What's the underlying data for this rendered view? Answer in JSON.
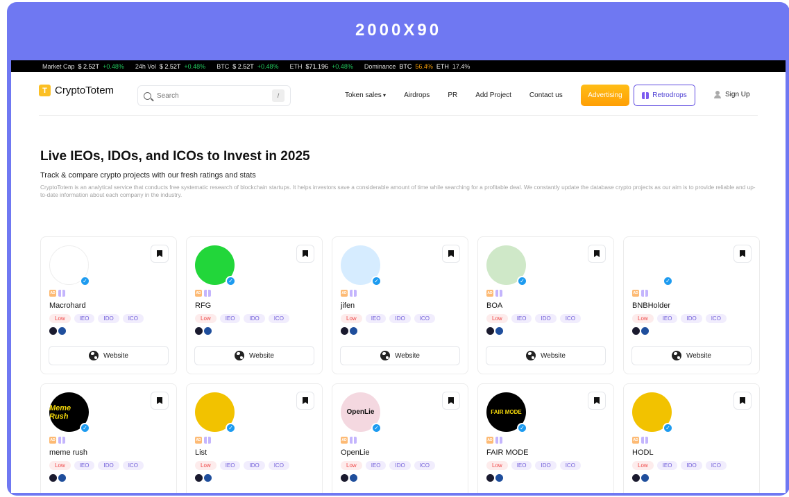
{
  "banner": {
    "text": "2000X90"
  },
  "ticker": {
    "market_cap_label": "Market Cap",
    "market_cap_value": "$ 2.52T",
    "market_cap_change": "+0.48%",
    "vol_label": "24h Vol",
    "vol_value": "$ 2.52T",
    "vol_change": "+0.48%",
    "btc_label": "BTC",
    "btc_value": "$ 2.52T",
    "btc_change": "+0.48%",
    "eth_label": "ETH",
    "eth_value": "$71.196",
    "eth_change": "+0.48%",
    "dominance_label": "Dominance",
    "dom_btc_label": "BTC",
    "dom_btc_value": "56.4%",
    "dom_eth_label": "ETH",
    "dom_eth_value": "17.4%"
  },
  "header": {
    "logo_text": "CryptoTotem",
    "search_placeholder": "Search",
    "search_shortcut": "/",
    "menu": [
      "Token sales",
      "Airdrops",
      "PR",
      "Add Project",
      "Contact us"
    ],
    "advertising_label": "Advertising",
    "retrodrops_label": "Retrodrops",
    "signup_label": "Sign Up"
  },
  "hero": {
    "title": "Live IEOs, IDOs, and ICOs to Invest in 2025",
    "subtitle": "Track & compare crypto projects with our fresh ratings and stats",
    "description": "CryptoTotem is an analytical service that conducts free systematic research of blockchain startups. It helps investors save a considerable amount of time while searching for a profitable deal. We constantly update the database crypto projects as our aim is to provide reliable and up-to-date information about each company in the industry."
  },
  "cards": [
    {
      "name": "Macrohard",
      "avatar": "macro",
      "avatar_text": "",
      "risk": "Low",
      "types": [
        "IEO",
        "IDO",
        "ICO"
      ],
      "website_label": "Website"
    },
    {
      "name": "RFG",
      "avatar": "rfg",
      "avatar_text": "",
      "risk": "Low",
      "types": [
        "IEO",
        "IDO",
        "ICO"
      ],
      "website_label": "Website"
    },
    {
      "name": "jifen",
      "avatar": "jifen",
      "avatar_text": "",
      "risk": "Low",
      "types": [
        "IEO",
        "IDO",
        "ICO"
      ],
      "website_label": "Website"
    },
    {
      "name": "BOA",
      "avatar": "boa",
      "avatar_text": "",
      "risk": "Low",
      "types": [
        "IEO",
        "IDO",
        "ICO"
      ],
      "website_label": "Website"
    },
    {
      "name": "BNBHolder",
      "avatar": "bnb",
      "avatar_text": "",
      "risk": "Low",
      "types": [
        "IEO",
        "IDO",
        "ICO"
      ],
      "website_label": "Website"
    },
    {
      "name": "meme rush",
      "avatar": "meme",
      "avatar_text": "Meme Rush",
      "risk": "Low",
      "types": [
        "IEO",
        "IDO",
        "ICO"
      ],
      "website_label": "Website"
    },
    {
      "name": "List",
      "avatar": "list",
      "avatar_text": "",
      "risk": "Low",
      "types": [
        "IEO",
        "IDO",
        "ICO"
      ],
      "website_label": "Website"
    },
    {
      "name": "OpenLie",
      "avatar": "open",
      "avatar_text": "OpenLie",
      "risk": "Low",
      "types": [
        "IEO",
        "IDO",
        "ICO"
      ],
      "website_label": "Website"
    },
    {
      "name": "FAIR MODE",
      "avatar": "fair",
      "avatar_text": "FAIR MODE",
      "risk": "Low",
      "types": [
        "IEO",
        "IDO",
        "ICO"
      ],
      "website_label": "Website"
    },
    {
      "name": "HODL",
      "avatar": "hodl",
      "avatar_text": "",
      "risk": "Low",
      "types": [
        "IEO",
        "IDO",
        "ICO"
      ],
      "website_label": "Website"
    }
  ],
  "labels": {
    "ad_badge": "AD"
  },
  "colors": {
    "banner": "#6f78f2",
    "accent_orange": "#ff9f05",
    "accent_purple": "#5b47e0",
    "positive": "#22c55e",
    "verified": "#1d9bf0"
  }
}
